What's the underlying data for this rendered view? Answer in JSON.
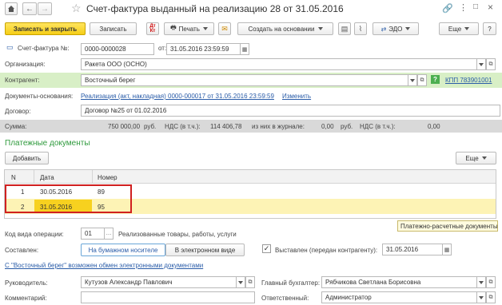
{
  "window": {
    "title": "Счет-фактура выданный на реализацию 28 от 31.05.2016"
  },
  "toolbar": {
    "save_close": "Записать и закрыть",
    "save": "Записать",
    "print": "Печать",
    "create_based": "Создать на основании",
    "edo": "ЭДО",
    "more": "Еще",
    "help": "?"
  },
  "header": {
    "invoice_no_label": "Счет-фактура №:",
    "invoice_no": "0000-0000028",
    "from_label": "от:",
    "date": "31.05.2016 23:59:59"
  },
  "form": {
    "org_label": "Организация:",
    "org": "Ракета ООО (ОСНО)",
    "contractor_label": "Контрагент:",
    "contractor": "Восточный берег",
    "kpp": "КПП 783901001",
    "basis_label": "Документы-основания:",
    "basis_link": "Реализация (акт, накладная) 0000-000017 от 31.05.2016 23:59:59",
    "change_link": "Изменить",
    "contract_label": "Договор:",
    "contract": "Договор №25 от 01.02.2016"
  },
  "sum_bar": {
    "sum_label": "Сумма:",
    "sum": "750 000,00",
    "rub1": "руб.",
    "vat_label1": "НДС (в т.ч.):",
    "vat": "114 406,78",
    "journal_label": "из них в журнале:",
    "journal": "0,00",
    "rub2": "руб.",
    "vat_label2": "НДС (в т.ч.):",
    "vat2": "0,00"
  },
  "payments": {
    "title": "Платежные документы",
    "add_button": "Добавить",
    "more": "Еще",
    "columns": [
      "N",
      "Дата",
      "Номер"
    ],
    "rows": [
      {
        "n": "1",
        "date": "30.05.2016",
        "number": "89"
      },
      {
        "n": "2",
        "date": "31.05.2016",
        "number": "95"
      }
    ],
    "tooltip": "Платежно-расчетные документы"
  },
  "footer": {
    "op_code_label": "Код вида операции:",
    "op_code": "01",
    "op_desc": "Реализованные товары, работы, услуги",
    "composed_label": "Составлен:",
    "paper": "На бумажном носителе",
    "electronic": "В электронном виде",
    "issued_label": "Выставлен (передан контрагенту):",
    "issued_date": "31.05.2016",
    "edo_link": "С \"Восточный берег\" возможен обмен электронными документами",
    "head_label": "Руководитель:",
    "head": "Кутузов Александр Павлович",
    "accountant_label": "Главный бухгалтер:",
    "accountant": "Рябчикова Светлана Борисовна",
    "comment_label": "Комментарий:",
    "comment": "",
    "responsible_label": "Ответственный:",
    "responsible": "Администратор"
  },
  "colors": {
    "accent_yellow": "#f5cd17",
    "highlight_row": "#fdf3b5",
    "selected_cell": "#f7d11f",
    "green_title": "#2e9a3c",
    "contractor_bg": "#d8efc6",
    "sum_bar_bg": "#d9d9d9",
    "red_border": "#d02020"
  }
}
